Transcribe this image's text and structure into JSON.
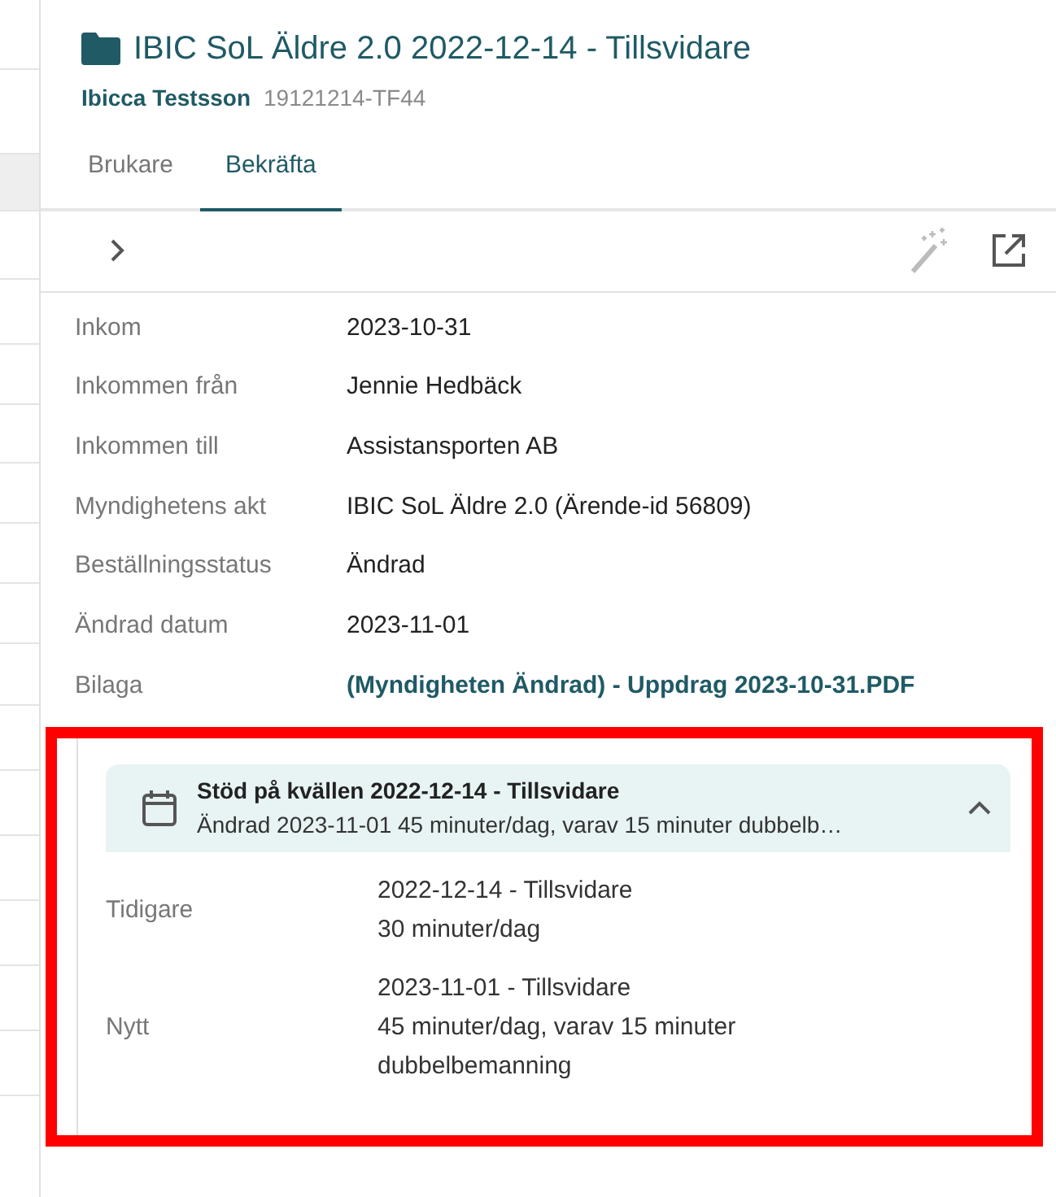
{
  "header": {
    "title": "IBIC SoL Äldre 2.0 2022-12-14 - Tillsvidare",
    "person_name": "Ibicca Testsson",
    "person_id": "19121214-TF44"
  },
  "tabs": [
    {
      "label": "Brukare",
      "selected": false
    },
    {
      "label": "Bekräfta",
      "selected": true
    }
  ],
  "details": [
    {
      "label": "Inkom",
      "value": "2023-10-31",
      "kind": "text"
    },
    {
      "label": "Inkommen från",
      "value": "Jennie Hedbäck",
      "kind": "text"
    },
    {
      "label": "Inkommen till",
      "value": "Assistansporten AB",
      "kind": "text"
    },
    {
      "label": "Myndighetens akt",
      "value": "IBIC SoL Äldre 2.0 (Ärende-id 56809)",
      "kind": "text"
    },
    {
      "label": "Beställningsstatus",
      "value": "Ändrad",
      "kind": "text"
    },
    {
      "label": "Ändrad datum",
      "value": "2023-11-01",
      "kind": "text"
    },
    {
      "label": "Bilaga",
      "value": "(Myndigheten Ändrad) - Uppdrag 2023-10-31.PDF",
      "kind": "link"
    }
  ],
  "change": {
    "title": "Stöd på kvällen 2022-12-14 - Tillsvidare",
    "summary": "Ändrad 2023-11-01 45 minuter/dag, varav 15 minuter dubbelb…",
    "expanded": true,
    "rows": [
      {
        "label": "Tidigare",
        "lines": [
          "2022-12-14 - Tillsvidare",
          "30 minuter/dag"
        ]
      },
      {
        "label": "Nytt",
        "lines": [
          "2023-11-01 - Tillsvidare",
          "45 minuter/dag, varav 15 minuter dubbelbemanning"
        ]
      }
    ]
  }
}
